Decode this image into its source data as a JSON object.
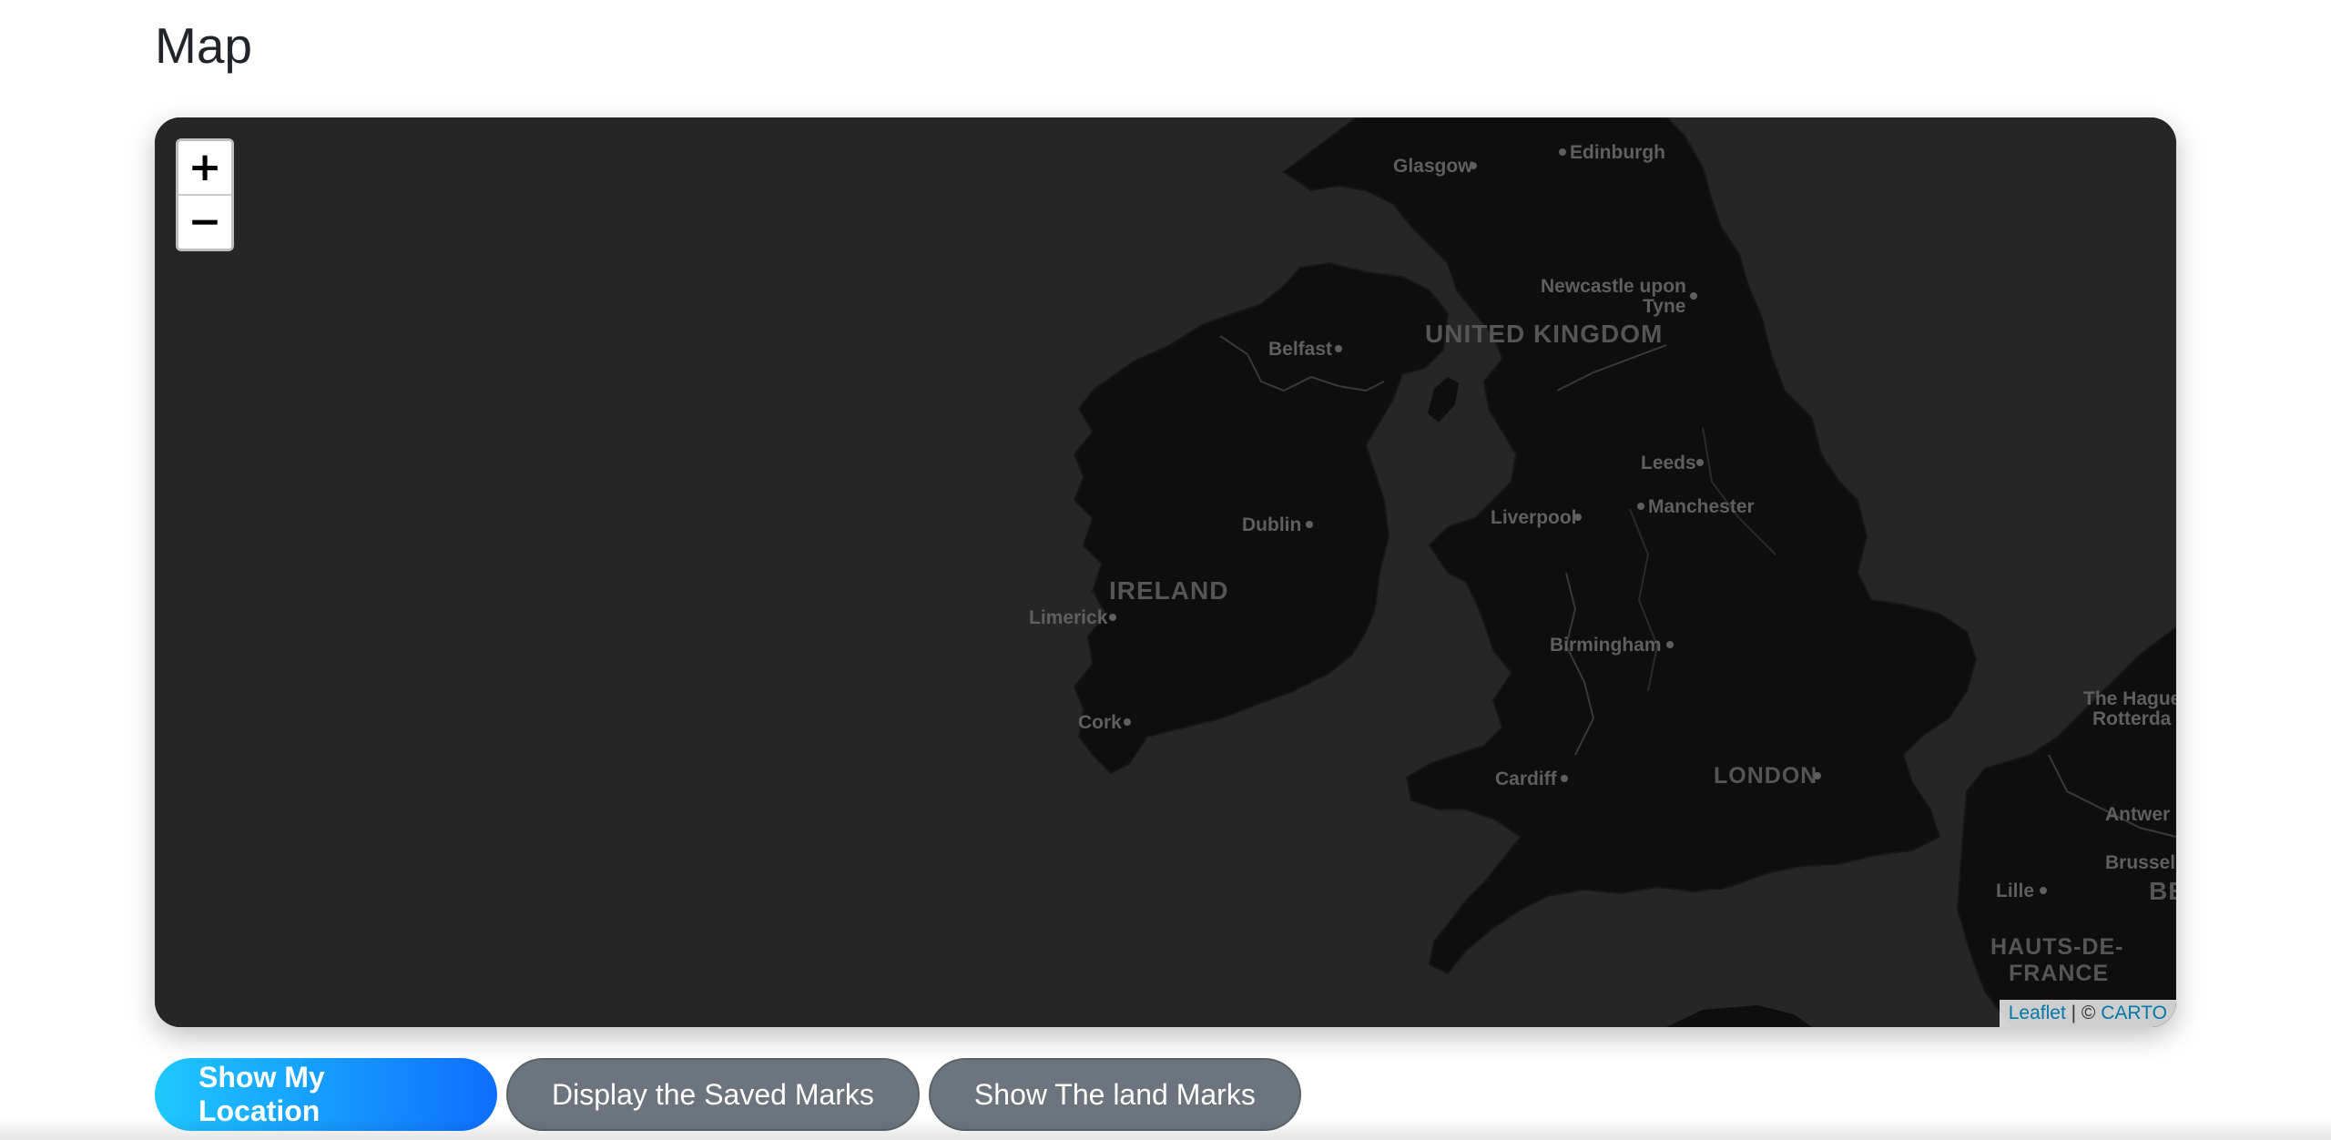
{
  "page": {
    "title": "Map"
  },
  "map": {
    "zoom_in_label": "+",
    "zoom_out_label": "−",
    "attribution": {
      "leaflet": "Leaflet",
      "separator": " | © ",
      "carto": "CARTO"
    },
    "colors": {
      "water": "#262626",
      "land": "#0e0e0e",
      "border": "#3a3a3a",
      "label": "#5f5f5f"
    },
    "labels": {
      "glasgow": "Glasgow",
      "edinburgh": "Edinburgh",
      "newcastle_1": "Newcastle upon",
      "newcastle_2": "Tyne",
      "uk": "UNITED KINGDOM",
      "belfast": "Belfast",
      "leeds": "Leeds",
      "liverpool": "Liverpool",
      "manchester": "Manchester",
      "dublin": "Dublin",
      "ireland": "IRELAND",
      "limerick": "Limerick",
      "birmingham": "Birmingham",
      "cork": "Cork",
      "the_hague": "The Hague",
      "rotterdam": "Rotterda",
      "cardiff": "Cardiff",
      "london": "LONDON",
      "antwerp": "Antwer",
      "brussels": "Brussel",
      "lille": "Lille",
      "be": "BE",
      "hauts_1": "HAUTS-DE-",
      "hauts_2": "FRANCE"
    }
  },
  "buttons": {
    "show_location": "Show My Location",
    "saved_marks": "Display the Saved Marks",
    "land_marks": "Show The land Marks"
  }
}
